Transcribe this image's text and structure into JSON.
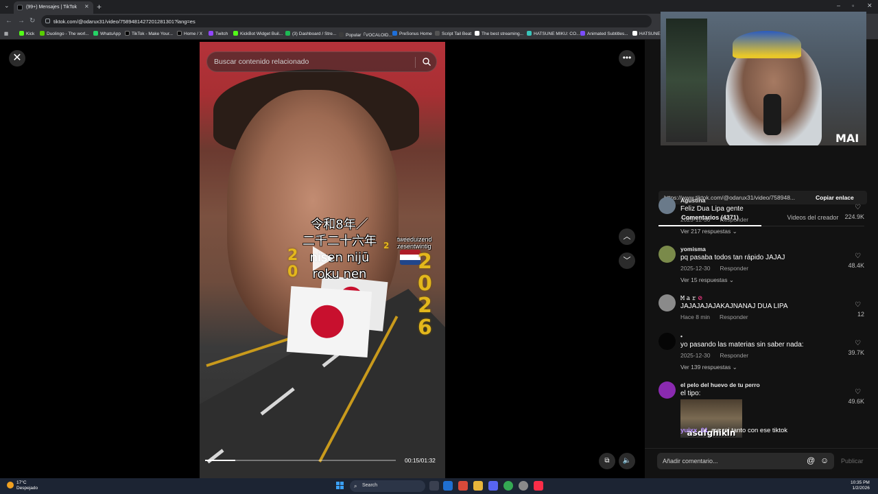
{
  "browser": {
    "tab_title": "(99+) Mensajes | TikTok",
    "url": "tiktok.com/@odarux31/video/7589481427201281301?lang=es",
    "bookmarks": [
      {
        "label": "Kick",
        "color": "#53fc18"
      },
      {
        "label": "Duolingo - The worl...",
        "color": "#58cc02"
      },
      {
        "label": "WhatsApp",
        "color": "#25d366"
      },
      {
        "label": "TikTok - Make Your...",
        "color": "#000000"
      },
      {
        "label": "Home / X",
        "color": "#000000"
      },
      {
        "label": "Twitch",
        "color": "#9146ff"
      },
      {
        "label": "KickBot Widget Buil...",
        "color": "#53fc18"
      },
      {
        "label": "(3) Dashboard / Stre...",
        "color": "#1db954"
      },
      {
        "label": "Popular「VOCALOID...",
        "color": "#3d3d3d"
      },
      {
        "label": "PreSonus Home",
        "color": "#1e6fd9"
      },
      {
        "label": "Script Tail Beat",
        "color": "#555555"
      },
      {
        "label": "The best streaming...",
        "color": "#ffffff"
      },
      {
        "label": "HATSUNE MIKU: CO...",
        "color": "#39c5bb"
      },
      {
        "label": "Animated Subtitles...",
        "color": "#7b4dff"
      },
      {
        "label": "HATSUNE M",
        "color": "#ffffff"
      }
    ]
  },
  "video": {
    "search_placeholder": "Buscar contenido relacionado",
    "overlay_jp_line1": "令和8年／",
    "overlay_jp_line2": "二千二十六年",
    "overlay_romaji_line1": "nisen nijū",
    "overlay_romaji_line2": "roku nen",
    "overlay_nl_line1": "tweeduizend",
    "overlay_nl_line2": "zesentwintig",
    "time": "00:15/01:32",
    "progress": 0.16
  },
  "panel": {
    "share_url": "https://www.tiktok.com/@odarux31/video/758948...",
    "copy_link_label": "Copiar enlace",
    "tab_comments": "Comentarios (4371)",
    "tab_videos": "Videos del creador",
    "comments": [
      {
        "user": "Agustina",
        "text": "Feliz Dua Lipa gente",
        "date": "2025-12-30",
        "reply": "Responder",
        "replies": "Ver 217 respuestas",
        "likes": "224.9K",
        "avatar_color": "#6a7a8a"
      },
      {
        "user": "yomisma",
        "text": "pq pasaba todos tan rápido JAJAJ",
        "date": "2025-12-30",
        "reply": "Responder",
        "replies": "Ver 15 respuestas",
        "likes": "48.4K",
        "avatar_color": "#7a8a4a"
      },
      {
        "user": "𝙼 𝚊 𝚛",
        "text": "JAJAJAJAJAKAJNANAJ DUA LIPA",
        "date": "Hace 8 min",
        "reply": "Responder",
        "replies": "",
        "likes": "12",
        "avatar_color": "#8a8a8a"
      },
      {
        "user": "•",
        "text": "yo pasando las materias sin saber nada:",
        "date": "2025-12-30",
        "reply": "Responder",
        "replies": "Ver 139 respuestas",
        "likes": "39.7K",
        "avatar_color": "#050505"
      },
      {
        "user": "el pelo del huevo de tu perro",
        "text": "el tipo:",
        "date": "",
        "reply": "",
        "replies": "",
        "likes": "49.6K",
        "avatar_color": "#8a2ab0",
        "image_caption": "asdfghikln"
      }
    ],
    "comment_placeholder": "Añadir comentario...",
    "publish_label": "Publicar",
    "chat_user": "yuixx_01",
    "chat_message": "me rei tanto con ese tiktok"
  },
  "taskbar": {
    "weather_temp": "17°C",
    "weather_desc": "Despejado",
    "search_label": "Search",
    "time": "10:35 PM",
    "date": "1/2/2026"
  },
  "colors": {
    "accent_red": "#c8102e",
    "gold": "#e3b71c",
    "panel_bg": "#121212"
  }
}
